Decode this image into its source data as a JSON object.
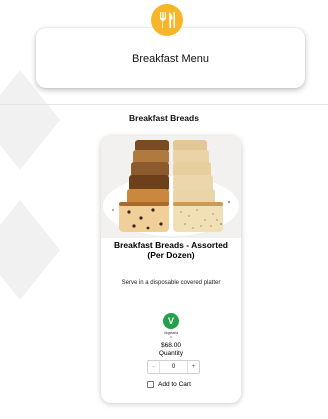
{
  "header": {
    "title": "Breakfast Menu",
    "logo_icon": "utensils-icon",
    "logo_color": "#f7b529"
  },
  "section": {
    "title": "Breakfast Breads"
  },
  "product": {
    "image_alt_icon": "bread-icon",
    "title": "Breakfast Breads - Assorted (Per Dozen)",
    "description": "Serve in a disposable covered platter",
    "diet_badge_letter": "V",
    "diet_badge_color": "#22a04b",
    "diet_label": "Vegetaria",
    "diet_sublabel": "n",
    "price": "$68.00",
    "quantity_label": "Quantity",
    "quantity_value": "0",
    "minus_label": "-",
    "plus_label": "+",
    "add_to_cart_label": "Add to Cart"
  }
}
